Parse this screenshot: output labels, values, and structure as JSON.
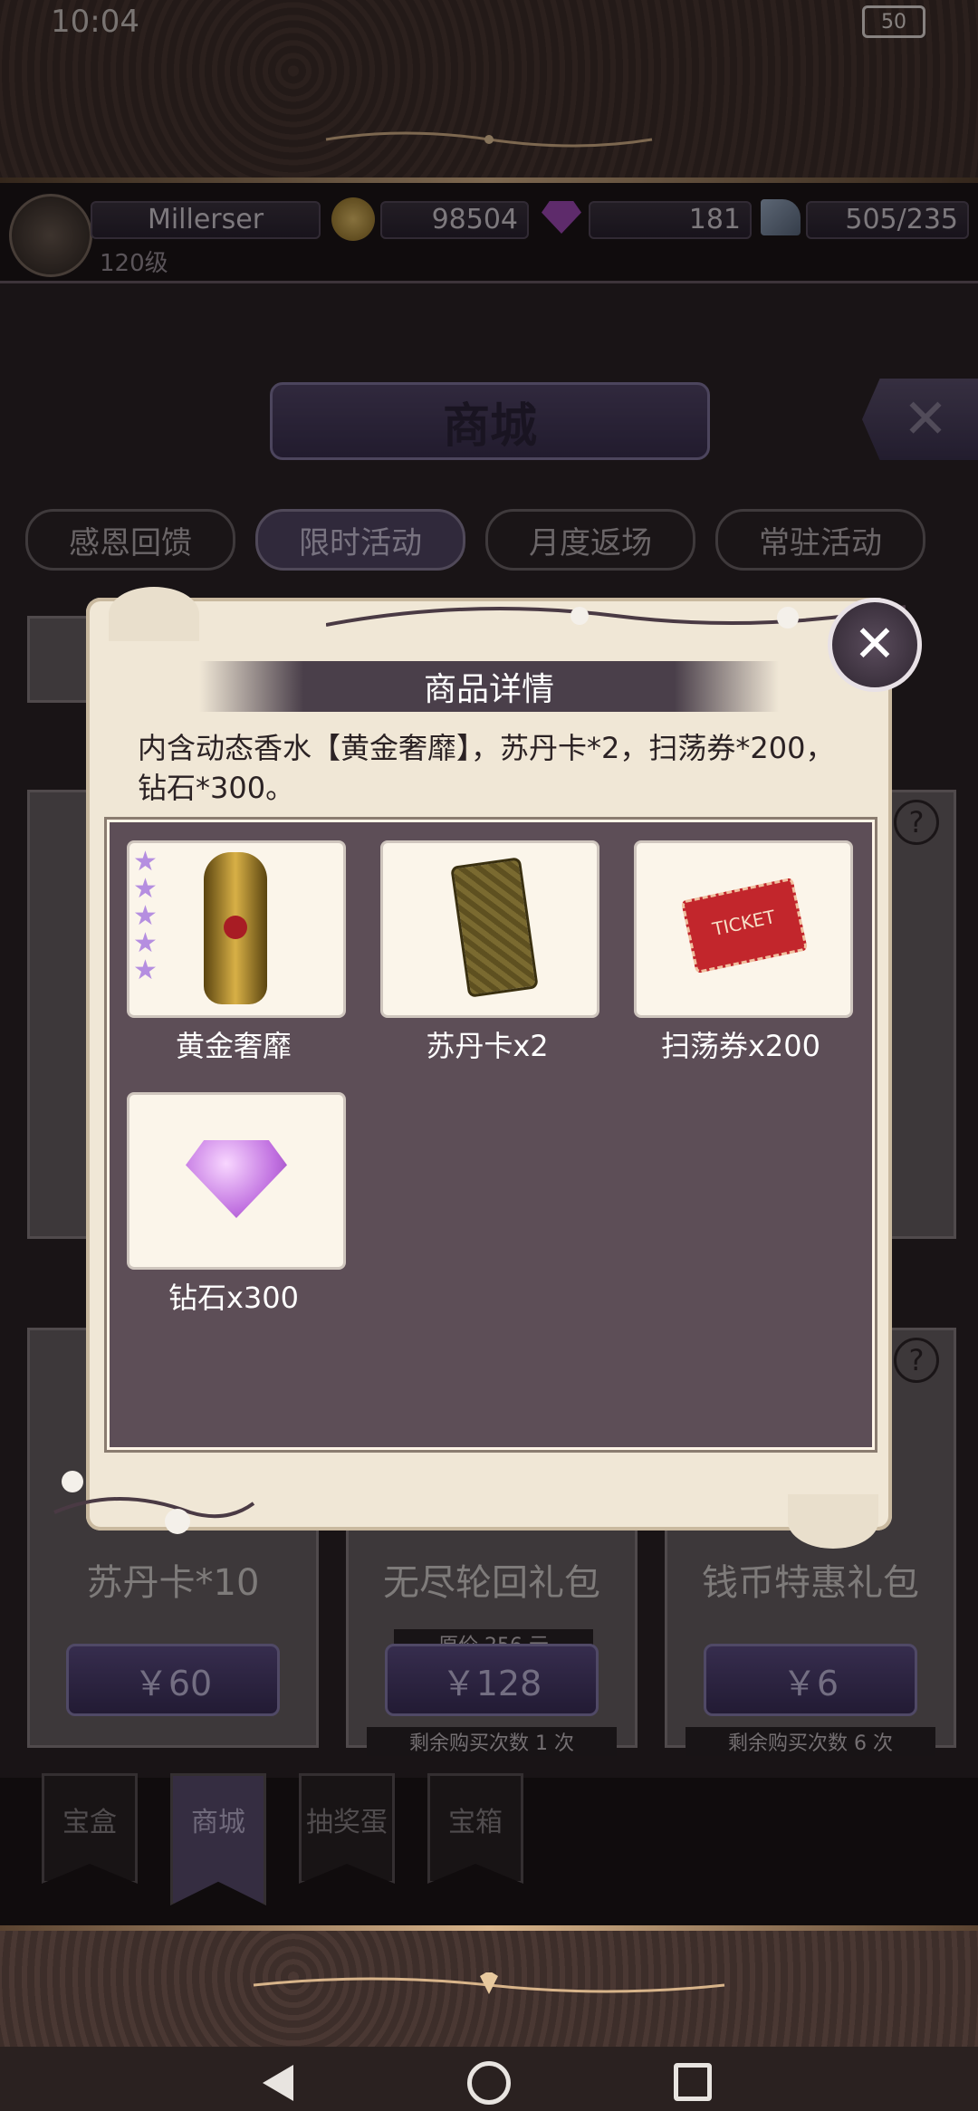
{
  "status_bar": {
    "time": "10:04",
    "battery": "50"
  },
  "profile": {
    "name": "Millerser",
    "level": "120级"
  },
  "currencies": {
    "coins": "98504",
    "gems": "181",
    "stamina": "505/235"
  },
  "gem_counter": "181",
  "header": {
    "title": "商城"
  },
  "tabs": [
    "感恩回馈",
    "限时活动",
    "月度返场",
    "常驻活动"
  ],
  "shop_cards": [
    {
      "title": "苏丹卡*10",
      "price": "￥60",
      "remaining": ""
    },
    {
      "title": "无尽轮回礼包",
      "price": "￥128",
      "original_price": "原价 256 元",
      "remaining": "剩余购买次数 1 次"
    },
    {
      "title": "钱币特惠礼包",
      "price": "￥6",
      "remaining": "剩余购买次数 6 次"
    }
  ],
  "popup": {
    "title": "商品详情",
    "description": "内含动态香水【黄金奢靡】，苏丹卡*2，扫荡券*200，钻石*300。",
    "items": [
      {
        "label": "黄金奢靡",
        "icon": "golden-perfume-icon"
      },
      {
        "label": "苏丹卡x2",
        "icon": "sultan-card-icon"
      },
      {
        "label": "扫荡券x200",
        "icon": "ticket-icon"
      },
      {
        "label": "钻石x300",
        "icon": "diamond-icon"
      }
    ]
  },
  "bottom_tabs": [
    "宝盒",
    "商城",
    "抽奖蛋",
    "宝箱"
  ],
  "colors": {
    "accent_purple": "#544767",
    "parchment": "#f0e7d6",
    "inner_panel": "#5d4e57"
  }
}
